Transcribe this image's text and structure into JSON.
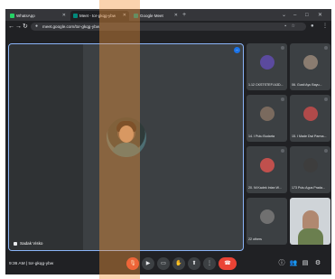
{
  "browser": {
    "tabs": [
      {
        "label": "WhatsApp",
        "active": false,
        "favicon_color": "#25d366"
      },
      {
        "label": "Meet - tor-gkqg-ybw",
        "active": true,
        "favicon_color": "#00897b"
      },
      {
        "label": "Google Meet",
        "active": false,
        "favicon_color": "#00897b"
      }
    ],
    "new_tab": "+",
    "window_controls": [
      "⌄",
      "–",
      "□",
      "✕"
    ],
    "url": "meet.google.com/tor-gkqg-ybw",
    "icons": [
      "back-icon",
      "forward-icon",
      "reload-icon",
      "lock-icon",
      "camera-icon",
      "star-icon",
      "extensions-icon",
      "profile-icon",
      "menu-icon"
    ]
  },
  "meet": {
    "self_name": "Sadak Visko",
    "more_icon": "⋯",
    "participants": [
      {
        "name": "1.12 CKSTSTEFI A3D...",
        "avatar_color": "#5b4a9e"
      },
      {
        "name": "06. Gusti Ayu Bayu...",
        "avatar_color": "#8a7c70"
      },
      {
        "name": "14. I Putu Budarta",
        "avatar_color": "#7a6a5e"
      },
      {
        "name": "15. I Made Dwi Parma...",
        "avatar_color": "#b04a4a"
      },
      {
        "name": "20. Ni Kadek Intan W...",
        "avatar_color": "#c0504d"
      },
      {
        "name": "173 Putu Agus Prada...",
        "avatar_color": "#3d3d3d"
      },
      {
        "name": "22 others",
        "avatar_color": "#707070"
      }
    ],
    "time": "9:36 AM",
    "separator": "|",
    "meeting_code": "tor-gkqg-ybw",
    "controls": [
      "mic-icon",
      "camera-icon",
      "captions-icon",
      "raise-hand-icon",
      "present-icon",
      "more-options-icon",
      "end-call-icon"
    ],
    "right_controls": [
      "info-icon",
      "people-icon",
      "chat-icon",
      "activities-icon"
    ]
  },
  "colors": {
    "accent": "#8ab4f8",
    "end_call": "#ea4335",
    "watermark": "#f3973f"
  }
}
